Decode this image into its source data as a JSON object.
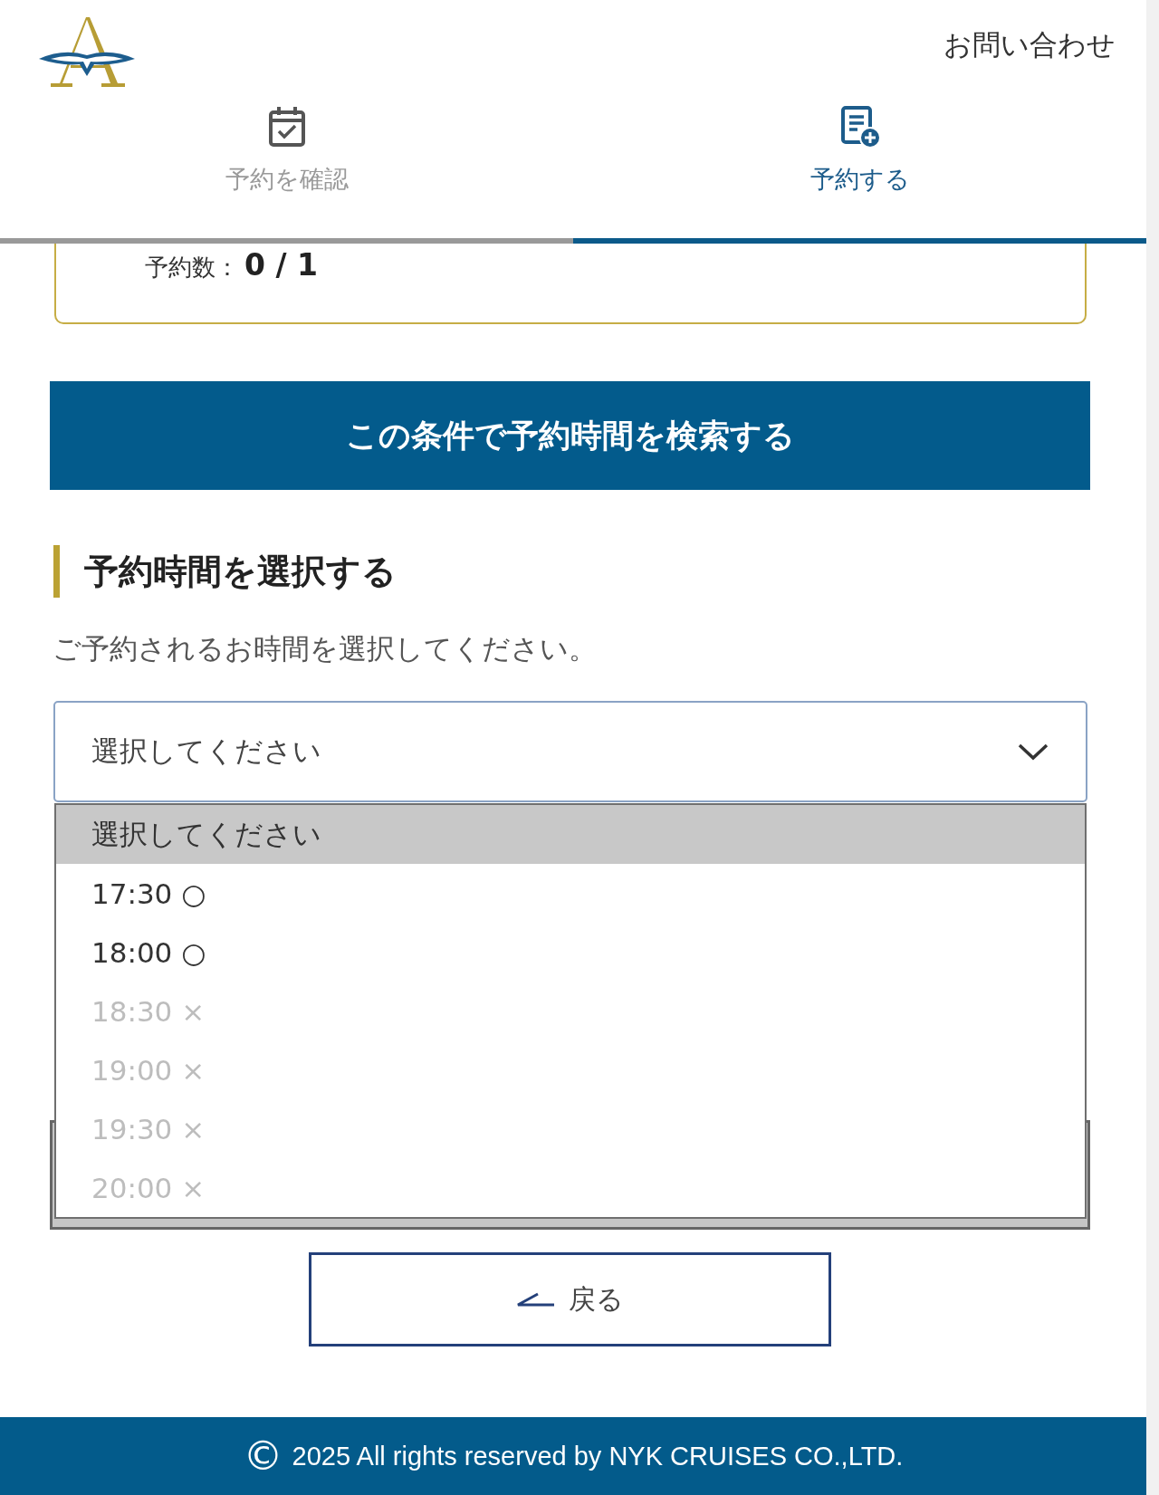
{
  "header": {
    "contact_link": "お問い合わせ"
  },
  "tabs": [
    {
      "label": "予約を確認",
      "selected": false
    },
    {
      "label": "予約する",
      "selected": true
    }
  ],
  "summary": {
    "label": "予約数：",
    "value": "0 / 1"
  },
  "search_button": "この条件で予約時間を検索する",
  "section": {
    "title": "予約時間を選択する",
    "description": "ご予約されるお時間を選択してください。"
  },
  "time_select": {
    "value": "選択してください",
    "expanded": true,
    "options": [
      {
        "label": "選択してください",
        "selected": true,
        "disabled": false
      },
      {
        "label": "17:30 ○",
        "selected": false,
        "disabled": false
      },
      {
        "label": "18:00 ○",
        "selected": false,
        "disabled": false
      },
      {
        "label": "18:30 ×",
        "selected": false,
        "disabled": true
      },
      {
        "label": "19:00 ×",
        "selected": false,
        "disabled": true
      },
      {
        "label": "19:30 ×",
        "selected": false,
        "disabled": true
      },
      {
        "label": "20:00 ×",
        "selected": false,
        "disabled": true
      }
    ]
  },
  "back_button": "戻る",
  "footer": {
    "symbol": "©",
    "text": "2025 All rights reserved by NYK CRUISES CO.,LTD."
  }
}
